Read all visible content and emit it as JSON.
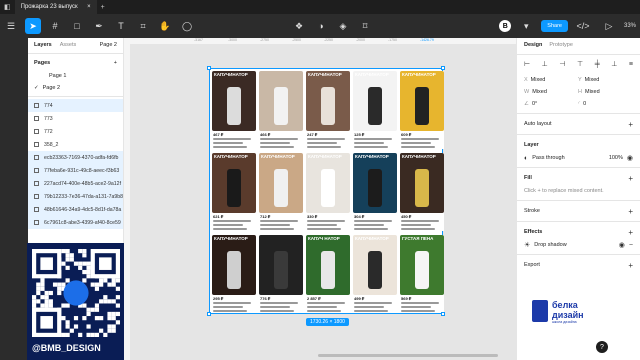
{
  "tab": {
    "title": "Прожарка 23 выпуск",
    "close": "×",
    "add": "+"
  },
  "toolbar": {
    "share_label": "Share",
    "avatar_letter": "B",
    "zoom": "33%"
  },
  "left_panel": {
    "tab_layers": "Layers",
    "tab_assets": "Assets",
    "page_selector": "Page 2",
    "pages_title": "Pages",
    "pages": [
      "Page 1",
      "Page 2"
    ],
    "current_page_check": "✓",
    "layers": [
      "774",
      "773",
      "772",
      "358_2",
      "ecb23363-7169-4370-adfa-fd6fb",
      "77feba6e-931c-49c8-aeec-f3b63",
      "227acd74-400e-48b5-ace2-9a12f",
      "79b12233-7e36-47da-a131-7a9b8",
      "48b61646-34a9-4dc5-8d1f-da78a",
      "6c7961c8-abe3-4399-af40-8ce59"
    ]
  },
  "handle": "@BMB_DESIGN",
  "ruler": {
    "left_ticks": [
      "-3167",
      "-3000",
      "-2750",
      "-2500",
      "-2250",
      "-2000",
      "-1750",
      "-1426.79"
    ]
  },
  "frame_dim": "1730.26 × 1800",
  "cards": [
    {
      "title": "КАПУЧИНАТОР",
      "price": "467 ₽",
      "color": "#3b2a24",
      "prod": "#dcdcdc"
    },
    {
      "title": "",
      "price": "466 ₽",
      "color": "#c9b8a6",
      "prod": "#f2f2f2"
    },
    {
      "title": "КАПУЧИНАТОР",
      "price": "247 ₽",
      "color": "#7a5b4a",
      "prod": "#e8e0d8"
    },
    {
      "title": "КАПУЧИНАТОР",
      "price": "125 ₽",
      "color": "#f3f3f3",
      "prod": "#2a2a2a"
    },
    {
      "title": "КАПУЧИНАТОР",
      "price": "609 ₽",
      "color": "#e7b52e",
      "prod": "#222222"
    },
    {
      "title": "КАПУЧИНАТОР",
      "price": "621 ₽",
      "color": "#5a3b2c",
      "prod": "#1a1a1a"
    },
    {
      "title": "КАПУЧИНАТОР",
      "price": "712 ₽",
      "color": "#caa886",
      "prod": "#f0f0f0"
    },
    {
      "title": "КАПУЧИНАТОР",
      "price": "330 ₽",
      "color": "#e8e4de",
      "prod": "#ffffff"
    },
    {
      "title": "КАПУЧИНАТОР",
      "price": "304 ₽",
      "color": "#15405a",
      "prod": "#1c1c1c"
    },
    {
      "title": "КАПУЧИНАТОР",
      "price": "450 ₽",
      "color": "#3a2a22",
      "prod": "#d8b84a"
    },
    {
      "title": "КАПУЧИНАТОР",
      "price": "295 ₽",
      "color": "#2a1c16",
      "prod": "#cfcfcf"
    },
    {
      "title": "",
      "price": "776 ₽",
      "color": "#222222",
      "prod": "#3a3a3a"
    },
    {
      "title": "КАПУЧ НАТОР",
      "price": "2 857 ₽",
      "color": "#2f6b2c",
      "prod": "#e8e8e8"
    },
    {
      "title": "КАПУЧИНАТОР",
      "price": "499 ₽",
      "color": "#ece4da",
      "prod": "#2a2a2a"
    },
    {
      "title": "ГУСТАЯ ПЕНА",
      "price": "569 ₽",
      "color": "#3e7a2e",
      "prod": "#f5f5f5"
    }
  ],
  "right_panel": {
    "tab_design": "Design",
    "tab_prototype": "Prototype",
    "x_label": "X",
    "x_val": "Mixed",
    "y_label": "Y",
    "y_val": "Mixed",
    "w_label": "W",
    "w_val": "Mixed",
    "h_label": "H",
    "h_val": "Mixed",
    "rot_label": "∠",
    "rot_val": "0°",
    "radius_label": "◜",
    "radius_val": "0",
    "auto_layout": "Auto layout",
    "layer": "Layer",
    "blend": "Pass through",
    "opacity": "100%",
    "fill": "Fill",
    "fill_hint": "Click + to replace mixed content.",
    "stroke": "Stroke",
    "effects": "Effects",
    "effect_item": "Drop shadow",
    "export": "Export"
  },
  "logo": {
    "line1": "белка",
    "line2": "дизайн",
    "line3": "школа дизайна"
  },
  "help": "?"
}
